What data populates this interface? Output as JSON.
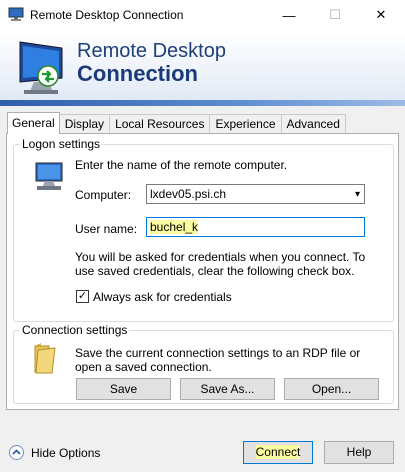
{
  "window": {
    "title": "Remote Desktop Connection",
    "minimize_glyph": "—",
    "maximize_glyph": "☐",
    "close_glyph": "✕"
  },
  "banner": {
    "line1": "Remote Desktop",
    "line2": "Connection"
  },
  "tabs": [
    {
      "label": "General",
      "active": true
    },
    {
      "label": "Display"
    },
    {
      "label": "Local Resources"
    },
    {
      "label": "Experience"
    },
    {
      "label": "Advanced"
    }
  ],
  "logon": {
    "legend": "Logon settings",
    "instruction": "Enter the name of the remote computer.",
    "computer_label": "Computer:",
    "computer_value": "lxdev05.psi.ch",
    "username_label": "User name:",
    "username_value": "buchel_k",
    "credentials_note": "You will be asked for credentials when you connect. To use saved credentials, clear the following check box.",
    "always_ask_label": "Always ask for credentials",
    "always_ask_checked": true
  },
  "connection": {
    "legend": "Connection settings",
    "description": "Save the current connection settings to an RDP file or open a saved connection.",
    "save_label": "Save",
    "save_as_label": "Save As...",
    "open_label": "Open..."
  },
  "footer": {
    "hide_options_label": "Hide Options",
    "connect_label": "Connect",
    "help_label": "Help"
  },
  "colors": {
    "accent": "#0078d7",
    "highlight": "#fbfba0",
    "title_text": "#1a3a78"
  }
}
